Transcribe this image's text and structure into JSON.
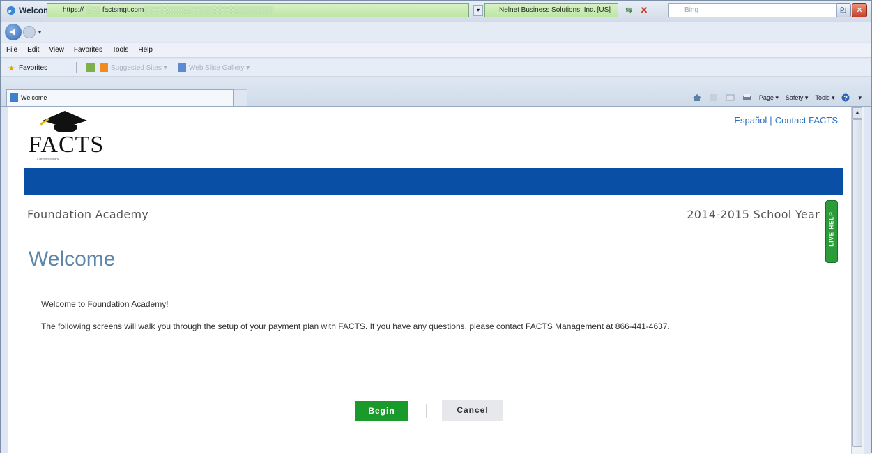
{
  "window": {
    "title": "Welcome - Windows Internet Explorer",
    "controls": {
      "minimize": "–",
      "maximize": "□",
      "close": "✕"
    }
  },
  "addressbar": {
    "url_visible": "https://",
    "url_domain": "factsmgt.com",
    "cert": "Nelnet Business Solutions, Inc. [US]",
    "search_placeholder": "Bing",
    "refresh": "⇆",
    "stop": "✕",
    "search_go": "ρ"
  },
  "menubar": [
    "File",
    "Edit",
    "View",
    "Favorites",
    "Tools",
    "Help"
  ],
  "favorites": {
    "label": "Favorites",
    "items": [
      "Suggested Sites ▾",
      "Web Slice Gallery ▾"
    ]
  },
  "tab": {
    "label": "Welcome"
  },
  "commandbar": {
    "page": "Page ▾",
    "safety": "Safety ▾",
    "tools": "Tools ▾",
    "help": "▾"
  },
  "page": {
    "logo_text": "FACTS",
    "logo_sub": "a nelnet company",
    "toplinks": {
      "espanol": "Español",
      "separator": "|",
      "contact": "Contact FACTS"
    },
    "school_name": "Foundation Academy",
    "school_year": "2014-2015 School Year",
    "live_help": "LIVE HELP",
    "heading": "Welcome",
    "message_1": "Welcome to Foundation Academy!",
    "message_2": "The following screens will walk you through the setup of your payment plan with FACTS.  If you have any questions, please contact FACTS Management at 866-441-4637.",
    "begin_label": "Begin",
    "cancel_label": "Cancel"
  },
  "colors": {
    "blue_bar": "#0a4fa6",
    "begin_button": "#1a9a2b",
    "heading": "#5f86a8",
    "link": "#2a70c2"
  }
}
